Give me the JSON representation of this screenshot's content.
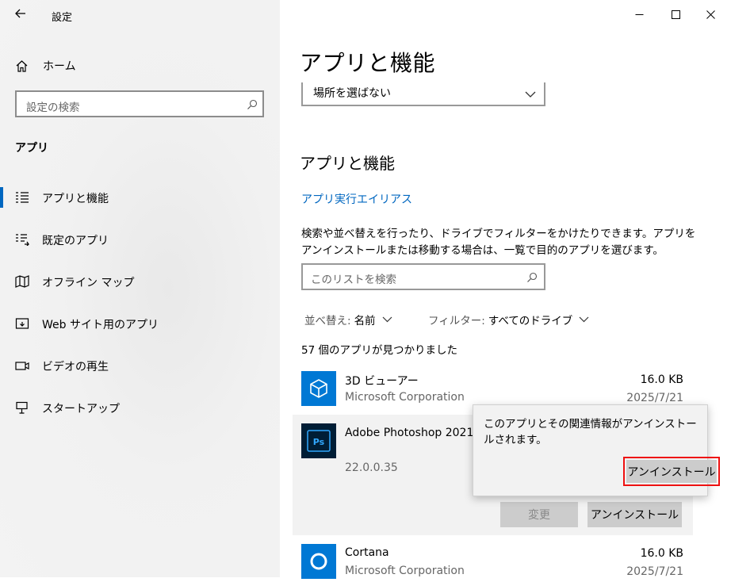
{
  "window": {
    "title": "設定"
  },
  "sidebar": {
    "home_label": "ホーム",
    "search_placeholder": "設定の検索",
    "section_label": "アプリ",
    "items": [
      {
        "label": "アプリと機能",
        "icon": "apps-features-icon",
        "selected": true
      },
      {
        "label": "既定のアプリ",
        "icon": "default-apps-icon"
      },
      {
        "label": "オフライン マップ",
        "icon": "offline-maps-icon"
      },
      {
        "label": "Web サイト用のアプリ",
        "icon": "websites-apps-icon"
      },
      {
        "label": "ビデオの再生",
        "icon": "video-playback-icon"
      },
      {
        "label": "スタートアップ",
        "icon": "startup-icon"
      }
    ]
  },
  "main": {
    "page_title": "アプリと機能",
    "install_location_dropdown": "場所を選ばない",
    "section_title": "アプリと機能",
    "alias_link": "アプリ実行エイリアス",
    "description": "検索や並べ替えを行ったり、ドライブでフィルターをかけたりできます。アプリをアンインストールまたは移動する場合は、一覧で目的のアプリを選びます。",
    "list_search_placeholder": "このリストを検索",
    "sort_label": "並べ替え:",
    "sort_value": "名前",
    "filter_label": "フィルター:",
    "filter_value": "すべてのドライブ",
    "app_count": "57 個のアプリが見つかりました",
    "apps": [
      {
        "name": "3D ビューアー",
        "publisher": "Microsoft Corporation",
        "size": "16.0 KB",
        "date": "2025/7/21"
      },
      {
        "name": "Adobe Photoshop 2021",
        "version": "22.0.0.35",
        "modify_label": "変更",
        "uninstall_label": "アンインストール"
      },
      {
        "name": "Cortana",
        "publisher": "Microsoft Corporation",
        "size": "16.0 KB",
        "date": "2025/7/21"
      }
    ]
  },
  "flyout": {
    "message": "このアプリとその関連情報がアンインストールされます。",
    "confirm_label": "アンインストール"
  },
  "colors": {
    "accent": "#0067c0",
    "highlight_border": "#e11111",
    "app_tile": "#0078d4"
  }
}
